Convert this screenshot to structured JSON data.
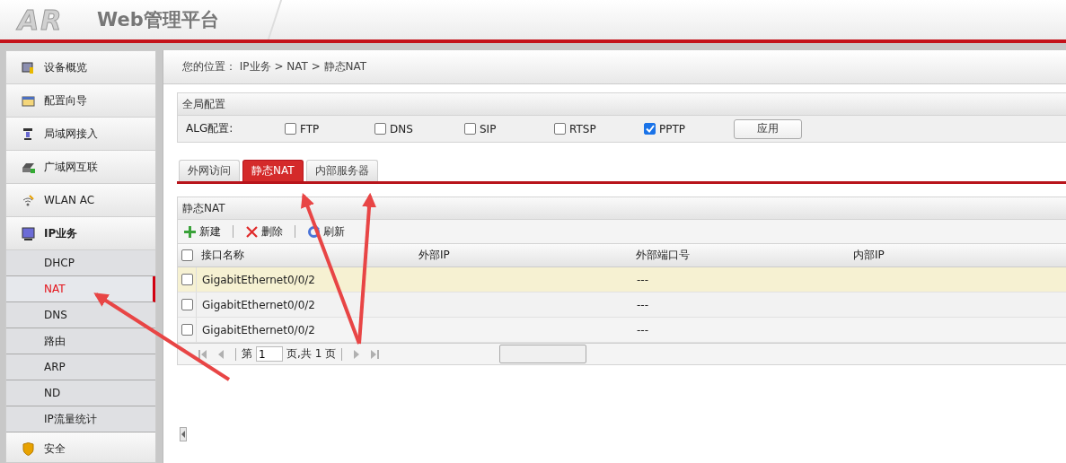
{
  "header": {
    "logo": "AR",
    "title": "Web管理平台"
  },
  "sidebar": {
    "items": [
      {
        "label": "设备概览",
        "expanded": false,
        "selected": false
      },
      {
        "label": "配置向导",
        "expanded": false,
        "selected": false
      },
      {
        "label": "局域网接入",
        "expanded": false,
        "selected": false
      },
      {
        "label": "广域网互联",
        "expanded": false,
        "selected": false
      },
      {
        "label": "WLAN AC",
        "expanded": false,
        "selected": false
      },
      {
        "label": "IP业务",
        "expanded": true,
        "selected": false,
        "children": [
          {
            "label": "DHCP",
            "selected": false
          },
          {
            "label": "NAT",
            "selected": true
          },
          {
            "label": "DNS",
            "selected": false
          },
          {
            "label": "路由",
            "selected": false
          },
          {
            "label": "ARP",
            "selected": false
          },
          {
            "label": "ND",
            "selected": false
          },
          {
            "label": "IP流量统计",
            "selected": false
          }
        ]
      },
      {
        "label": "安全",
        "expanded": false,
        "selected": false
      }
    ]
  },
  "breadcrumb": "您的位置： IP业务 > NAT > 静态NAT",
  "global_config": {
    "title": "全局配置",
    "label": "ALG配置:",
    "options": [
      {
        "label": "FTP",
        "checked": false
      },
      {
        "label": "DNS",
        "checked": false
      },
      {
        "label": "SIP",
        "checked": false
      },
      {
        "label": "RTSP",
        "checked": false
      },
      {
        "label": "PPTP",
        "checked": true
      }
    ],
    "apply_button": "应用"
  },
  "tabs": [
    {
      "label": "外网访问",
      "selected": false
    },
    {
      "label": "静态NAT",
      "selected": true
    },
    {
      "label": "内部服务器",
      "selected": false
    }
  ],
  "panel": {
    "title": "静态NAT",
    "toolbar": [
      {
        "label": "新建"
      },
      {
        "label": "删除"
      },
      {
        "label": "刷新"
      }
    ],
    "table": {
      "select_all_checked": false,
      "columns": [
        "接口名称",
        "外部IP",
        "外部端口号",
        "内部IP"
      ],
      "rows": [
        {
          "selected": true,
          "checked": false,
          "cells": [
            "GigabitEthernet0/0/2",
            "",
            "---",
            ""
          ]
        },
        {
          "selected": false,
          "checked": false,
          "cells": [
            "GigabitEthernet0/0/2",
            "",
            "---",
            ""
          ]
        },
        {
          "selected": false,
          "checked": false,
          "cells": [
            "GigabitEthernet0/0/2",
            "",
            "---",
            ""
          ]
        }
      ]
    },
    "pager": {
      "before": "第",
      "page": "1",
      "after": "页,共 1 页"
    }
  }
}
